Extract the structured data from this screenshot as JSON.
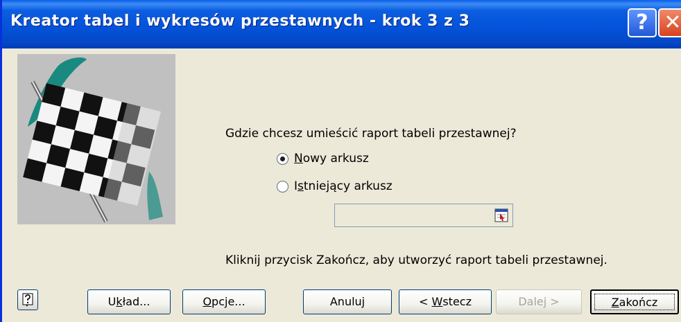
{
  "window": {
    "title": "Kreator tabel i wykresów przestawnych - krok 3 z 3",
    "help_glyph": "?",
    "close_glyph": "✕"
  },
  "colors": {
    "titlebar": "#0352d9",
    "face": "#ece9d8",
    "close": "#d8421f",
    "help": "#2259d8"
  },
  "content": {
    "question": "Gdzie chcesz umieścić raport tabeli przestawnej?",
    "options": [
      {
        "label_pre": "",
        "label_key": "N",
        "label_post": "owy arkusz",
        "checked": true
      },
      {
        "label_pre": "I",
        "label_key": "s",
        "label_post": "tniejący arkusz",
        "checked": false
      }
    ],
    "location_value": "",
    "info": "Kliknij przycisk Zakończ, aby utworzyć raport tabeli przestawnej."
  },
  "buttons": {
    "help_icon": "help-icon",
    "layout": {
      "pre": "U",
      "key": "k",
      "post": "ład..."
    },
    "options": {
      "pre": "",
      "key": "O",
      "post": "pcje..."
    },
    "cancel": "Anuluj",
    "back": {
      "pre": "< ",
      "key": "W",
      "post": "stecz"
    },
    "next": "Dalej >",
    "finish": {
      "pre": "",
      "key": "Z",
      "post": "akończ"
    }
  }
}
